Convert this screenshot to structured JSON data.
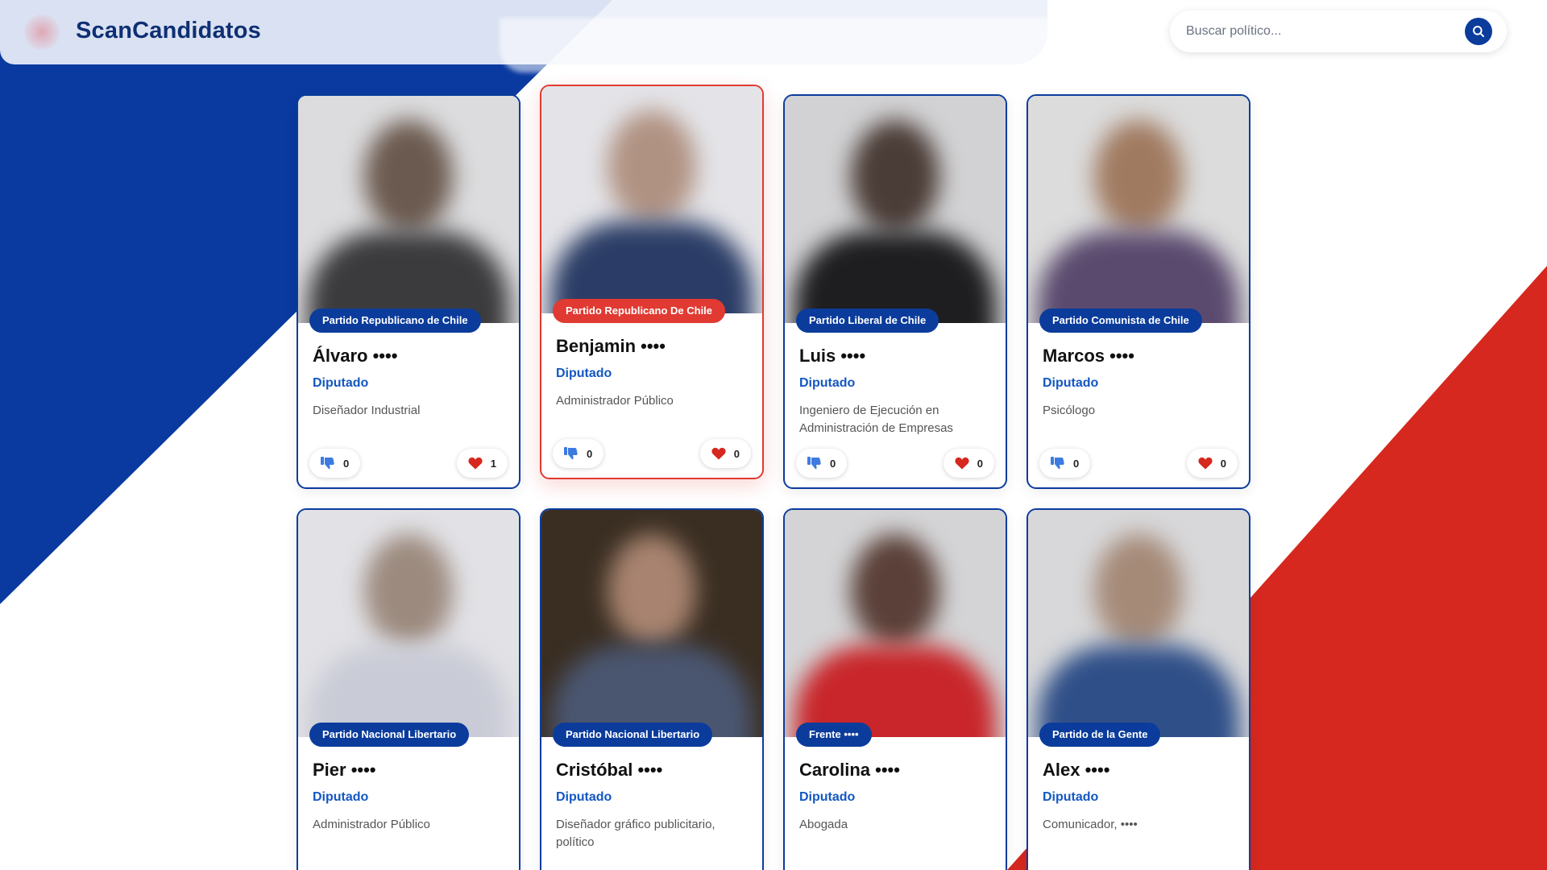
{
  "header": {
    "brand": "ScanCandidatos",
    "search_placeholder": "Buscar político..."
  },
  "icons": {
    "logo": "chile-flag-blurred-logo",
    "search": "search-icon",
    "dislike": "thumbs-down-icon",
    "like": "heart-icon"
  },
  "colors": {
    "brand_blue": "#0b3c9c",
    "accent_red": "#e03a32",
    "role_blue": "#1357c2"
  },
  "cards": [
    {
      "party": "Partido Republicano de Chile",
      "name": "Álvaro ••••",
      "role": "Diputado",
      "profession": "Diseñador Industrial",
      "dislikes": "0",
      "likes": "1"
    },
    {
      "party": "Partido Republicano De Chile",
      "name": "Benjamin ••••",
      "role": "Diputado",
      "profession": "Administrador Público",
      "dislikes": "0",
      "likes": "0"
    },
    {
      "party": "Partido Liberal de Chile",
      "name": "Luis ••••",
      "role": "Diputado",
      "profession": "Ingeniero de Ejecución en Administración de Empresas",
      "dislikes": "0",
      "likes": "0"
    },
    {
      "party": "Partido Comunista de Chile",
      "name": "Marcos ••••",
      "role": "Diputado",
      "profession": "Psicólogo",
      "dislikes": "0",
      "likes": "0"
    },
    {
      "party": "Partido Nacional Libertario",
      "name": "Pier ••••",
      "role": "Diputado",
      "profession": "Administrador Público",
      "dislikes": "",
      "likes": ""
    },
    {
      "party": "Partido Nacional Libertario",
      "name": "Cristóbal ••••",
      "role": "Diputado",
      "profession": "Diseñador gráfico publicitario, político",
      "dislikes": "",
      "likes": ""
    },
    {
      "party": "Frente ••••",
      "name": "Carolina ••••",
      "role": "Diputado",
      "profession": "Abogada",
      "dislikes": "",
      "likes": ""
    },
    {
      "party": "Partido de la Gente",
      "name": "Alex ••••",
      "role": "Diputado",
      "profession": "Comunicador, ••••",
      "dislikes": "",
      "likes": ""
    }
  ]
}
